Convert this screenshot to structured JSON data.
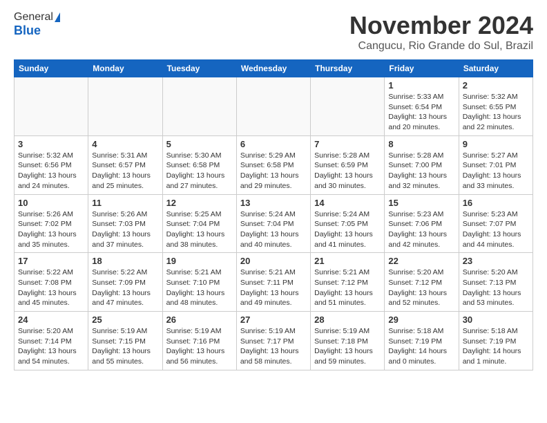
{
  "header": {
    "logo_general": "General",
    "logo_blue": "Blue",
    "month_title": "November 2024",
    "location": "Cangucu, Rio Grande do Sul, Brazil"
  },
  "weekdays": [
    "Sunday",
    "Monday",
    "Tuesday",
    "Wednesday",
    "Thursday",
    "Friday",
    "Saturday"
  ],
  "weeks": [
    [
      {
        "day": "",
        "detail": ""
      },
      {
        "day": "",
        "detail": ""
      },
      {
        "day": "",
        "detail": ""
      },
      {
        "day": "",
        "detail": ""
      },
      {
        "day": "",
        "detail": ""
      },
      {
        "day": "1",
        "detail": "Sunrise: 5:33 AM\nSunset: 6:54 PM\nDaylight: 13 hours\nand 20 minutes."
      },
      {
        "day": "2",
        "detail": "Sunrise: 5:32 AM\nSunset: 6:55 PM\nDaylight: 13 hours\nand 22 minutes."
      }
    ],
    [
      {
        "day": "3",
        "detail": "Sunrise: 5:32 AM\nSunset: 6:56 PM\nDaylight: 13 hours\nand 24 minutes."
      },
      {
        "day": "4",
        "detail": "Sunrise: 5:31 AM\nSunset: 6:57 PM\nDaylight: 13 hours\nand 25 minutes."
      },
      {
        "day": "5",
        "detail": "Sunrise: 5:30 AM\nSunset: 6:58 PM\nDaylight: 13 hours\nand 27 minutes."
      },
      {
        "day": "6",
        "detail": "Sunrise: 5:29 AM\nSunset: 6:58 PM\nDaylight: 13 hours\nand 29 minutes."
      },
      {
        "day": "7",
        "detail": "Sunrise: 5:28 AM\nSunset: 6:59 PM\nDaylight: 13 hours\nand 30 minutes."
      },
      {
        "day": "8",
        "detail": "Sunrise: 5:28 AM\nSunset: 7:00 PM\nDaylight: 13 hours\nand 32 minutes."
      },
      {
        "day": "9",
        "detail": "Sunrise: 5:27 AM\nSunset: 7:01 PM\nDaylight: 13 hours\nand 33 minutes."
      }
    ],
    [
      {
        "day": "10",
        "detail": "Sunrise: 5:26 AM\nSunset: 7:02 PM\nDaylight: 13 hours\nand 35 minutes."
      },
      {
        "day": "11",
        "detail": "Sunrise: 5:26 AM\nSunset: 7:03 PM\nDaylight: 13 hours\nand 37 minutes."
      },
      {
        "day": "12",
        "detail": "Sunrise: 5:25 AM\nSunset: 7:04 PM\nDaylight: 13 hours\nand 38 minutes."
      },
      {
        "day": "13",
        "detail": "Sunrise: 5:24 AM\nSunset: 7:04 PM\nDaylight: 13 hours\nand 40 minutes."
      },
      {
        "day": "14",
        "detail": "Sunrise: 5:24 AM\nSunset: 7:05 PM\nDaylight: 13 hours\nand 41 minutes."
      },
      {
        "day": "15",
        "detail": "Sunrise: 5:23 AM\nSunset: 7:06 PM\nDaylight: 13 hours\nand 42 minutes."
      },
      {
        "day": "16",
        "detail": "Sunrise: 5:23 AM\nSunset: 7:07 PM\nDaylight: 13 hours\nand 44 minutes."
      }
    ],
    [
      {
        "day": "17",
        "detail": "Sunrise: 5:22 AM\nSunset: 7:08 PM\nDaylight: 13 hours\nand 45 minutes."
      },
      {
        "day": "18",
        "detail": "Sunrise: 5:22 AM\nSunset: 7:09 PM\nDaylight: 13 hours\nand 47 minutes."
      },
      {
        "day": "19",
        "detail": "Sunrise: 5:21 AM\nSunset: 7:10 PM\nDaylight: 13 hours\nand 48 minutes."
      },
      {
        "day": "20",
        "detail": "Sunrise: 5:21 AM\nSunset: 7:11 PM\nDaylight: 13 hours\nand 49 minutes."
      },
      {
        "day": "21",
        "detail": "Sunrise: 5:21 AM\nSunset: 7:12 PM\nDaylight: 13 hours\nand 51 minutes."
      },
      {
        "day": "22",
        "detail": "Sunrise: 5:20 AM\nSunset: 7:12 PM\nDaylight: 13 hours\nand 52 minutes."
      },
      {
        "day": "23",
        "detail": "Sunrise: 5:20 AM\nSunset: 7:13 PM\nDaylight: 13 hours\nand 53 minutes."
      }
    ],
    [
      {
        "day": "24",
        "detail": "Sunrise: 5:20 AM\nSunset: 7:14 PM\nDaylight: 13 hours\nand 54 minutes."
      },
      {
        "day": "25",
        "detail": "Sunrise: 5:19 AM\nSunset: 7:15 PM\nDaylight: 13 hours\nand 55 minutes."
      },
      {
        "day": "26",
        "detail": "Sunrise: 5:19 AM\nSunset: 7:16 PM\nDaylight: 13 hours\nand 56 minutes."
      },
      {
        "day": "27",
        "detail": "Sunrise: 5:19 AM\nSunset: 7:17 PM\nDaylight: 13 hours\nand 58 minutes."
      },
      {
        "day": "28",
        "detail": "Sunrise: 5:19 AM\nSunset: 7:18 PM\nDaylight: 13 hours\nand 59 minutes."
      },
      {
        "day": "29",
        "detail": "Sunrise: 5:18 AM\nSunset: 7:19 PM\nDaylight: 14 hours\nand 0 minutes."
      },
      {
        "day": "30",
        "detail": "Sunrise: 5:18 AM\nSunset: 7:19 PM\nDaylight: 14 hours\nand 1 minute."
      }
    ]
  ]
}
